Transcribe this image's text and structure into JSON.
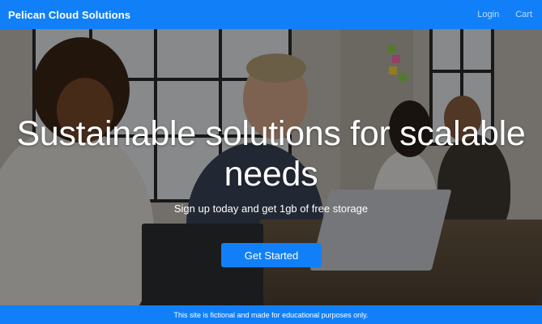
{
  "navbar": {
    "brand": "Pelican Cloud Solutions",
    "links": [
      {
        "label": "Login"
      },
      {
        "label": "Cart"
      }
    ]
  },
  "hero": {
    "title": "Sustainable solutions for scalable needs",
    "subtitle": "Sign up today and get 1gb of free storage",
    "cta_label": "Get Started",
    "background_icon": "office-meeting-photo"
  },
  "footer": {
    "text": "This site is fictional and made for educational purposes only."
  },
  "colors": {
    "brand_blue": "#1180f8",
    "text_white": "#ffffff"
  }
}
